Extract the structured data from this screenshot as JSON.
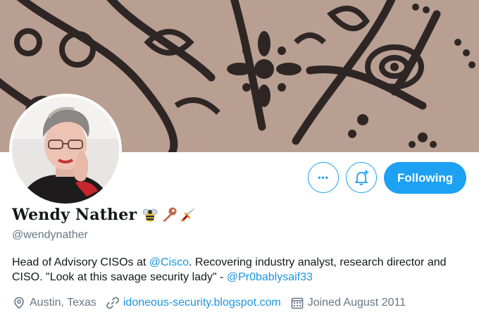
{
  "profile": {
    "display_name": "Wendy Nather",
    "handle": "@wendynather",
    "emoji_icons": [
      "bee-icon",
      "key-icon",
      "dagger-icon"
    ],
    "bio": {
      "part1": "Head of Advisory CISOs at ",
      "mention1": "@Cisco",
      "part2": ". Recovering industry analyst, research director and CISO. \"Look at this savage security lady\" - ",
      "mention2": "@Pr0bablysaif33"
    },
    "location": "Austin, Texas",
    "website": "idoneous-security.blogspot.com",
    "joined": "Joined August 2011"
  },
  "actions": {
    "more_label": "•••",
    "following_label": "Following"
  },
  "colors": {
    "accent": "#1da1f2",
    "link": "#1b95e0",
    "muted": "#657786"
  }
}
